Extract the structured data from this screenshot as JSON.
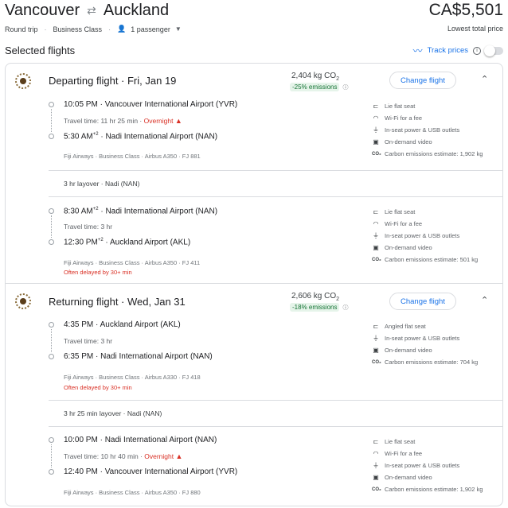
{
  "header": {
    "origin": "Vancouver",
    "destination": "Auckland",
    "price": "CA$5,501",
    "trip_type": "Round trip",
    "cabin": "Business Class",
    "passengers": "1 passenger",
    "price_note": "Lowest total price"
  },
  "selected": {
    "title": "Selected flights",
    "track_label": "Track prices"
  },
  "departing": {
    "title": "Departing flight · Fri, Jan 19",
    "co2": "2,404 kg CO",
    "co2_sub": "2",
    "emissions": "-25% emissions",
    "change_label": "Change flight",
    "seg1": {
      "dep_time": "10:05 PM",
      "dep_airport": "Vancouver International Airport (YVR)",
      "travel_time": "Travel time: 11 hr 25 min",
      "overnight": "Overnight",
      "arr_time": "5:30 AM",
      "arr_sup": "+2",
      "arr_airport": "Nadi International Airport (NAN)",
      "meta": "Fiji Airways · Business Class · Airbus A350 · FJ 881",
      "amenities": [
        "Lie flat seat",
        "Wi-Fi for a fee",
        "In-seat power & USB outlets",
        "On-demand video",
        "Carbon emissions estimate: 1,902 kg"
      ]
    },
    "layover": "3 hr layover · Nadi (NAN)",
    "seg2": {
      "dep_time": "8:30 AM",
      "dep_sup": "+2",
      "dep_airport": "Nadi International Airport (NAN)",
      "travel_time": "Travel time: 3 hr",
      "arr_time": "12:30 PM",
      "arr_sup": "+2",
      "arr_airport": "Auckland Airport (AKL)",
      "meta": "Fiji Airways · Business Class · Airbus A350 · FJ 411",
      "delay": "Often delayed by 30+ min",
      "amenities": [
        "Lie flat seat",
        "Wi-Fi for a fee",
        "In-seat power & USB outlets",
        "On-demand video",
        "Carbon emissions estimate: 501 kg"
      ]
    }
  },
  "returning": {
    "title": "Returning flight · Wed, Jan 31",
    "co2": "2,606 kg CO",
    "co2_sub": "2",
    "emissions": "-18% emissions",
    "change_label": "Change flight",
    "seg1": {
      "dep_time": "4:35 PM",
      "dep_airport": "Auckland Airport (AKL)",
      "travel_time": "Travel time: 3 hr",
      "arr_time": "6:35 PM",
      "arr_airport": "Nadi International Airport (NAN)",
      "meta": "Fiji Airways · Business Class · Airbus A330 · FJ 418",
      "delay": "Often delayed by 30+ min",
      "amenities": [
        "Angled flat seat",
        "In-seat power & USB outlets",
        "On-demand video",
        "Carbon emissions estimate: 704 kg"
      ]
    },
    "layover": "3 hr 25 min layover · Nadi (NAN)",
    "seg2": {
      "dep_time": "10:00 PM",
      "dep_airport": "Nadi International Airport (NAN)",
      "travel_time": "Travel time: 10 hr 40 min",
      "overnight": "Overnight",
      "arr_time": "12:40 PM",
      "arr_airport": "Vancouver International Airport (YVR)",
      "meta": "Fiji Airways · Business Class · Airbus A350 · FJ 880",
      "amenities": [
        "Lie flat seat",
        "Wi-Fi for a fee",
        "In-seat power & USB outlets",
        "On-demand video",
        "Carbon emissions estimate: 1,902 kg"
      ]
    }
  },
  "colors": {
    "accent": "#1a73e8",
    "warning": "#d93025",
    "eco_green": "#137333",
    "border": "#dadce0"
  }
}
